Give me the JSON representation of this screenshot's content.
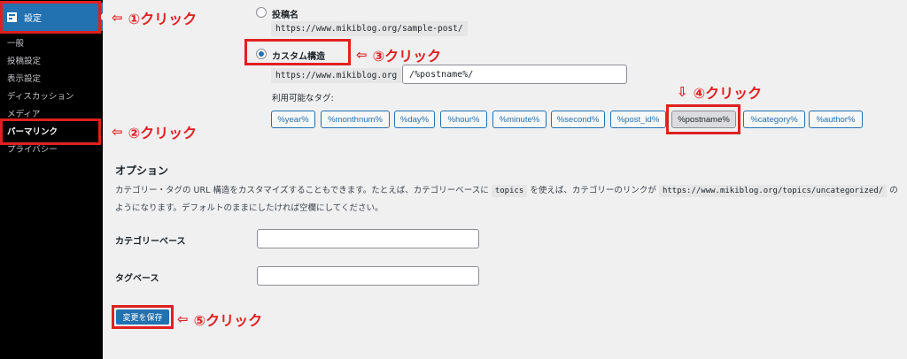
{
  "sidebar": {
    "settings_label": "設定",
    "items": [
      {
        "label": "一般"
      },
      {
        "label": "投稿設定"
      },
      {
        "label": "表示設定"
      },
      {
        "label": "ディスカッション"
      },
      {
        "label": "メディア"
      },
      {
        "label": "パーマリンク"
      },
      {
        "label": "プライバシー"
      }
    ]
  },
  "permalink": {
    "postname_label": "投稿名",
    "postname_example": "https://www.mikiblog.org/sample-post/",
    "custom_label": "カスタム構造",
    "custom_base": "https://www.mikiblog.org",
    "custom_value": "/%postname%/",
    "available_tags_label": "利用可能なタグ:",
    "tags": [
      "%year%",
      "%monthnum%",
      "%day%",
      "%hour%",
      "%minute%",
      "%second%",
      "%post_id%",
      "%postname%",
      "%category%",
      "%author%"
    ],
    "active_tag": "%postname%"
  },
  "options": {
    "title": "オプション",
    "desc_part1": "カテゴリー・タグの URL 構造をカスタマイズすることもできます。たとえば、カテゴリーベースに",
    "desc_code1": "topics",
    "desc_part2": "を使えば、カテゴリーのリンクが",
    "desc_code2": "https://www.mikiblog.org/topics/uncategorized/",
    "desc_part3": "の",
    "desc_line2": "ようになります。デフォルトのままにしたければ空欄にしてください。",
    "category_base_label": "カテゴリーベース",
    "category_base_value": "",
    "tag_base_label": "タグベース",
    "tag_base_value": "",
    "save_label": "変更を保存"
  },
  "annotations": {
    "a1": "①クリック",
    "a2": "②クリック",
    "a3": "③クリック",
    "a4": "④クリック",
    "a5": "⑤クリック",
    "arrow_left": "⇦",
    "arrow_down": "⇩"
  },
  "colors": {
    "highlight": "#e02020",
    "accent": "#2271b1",
    "sidebar_bg": "#000000"
  }
}
